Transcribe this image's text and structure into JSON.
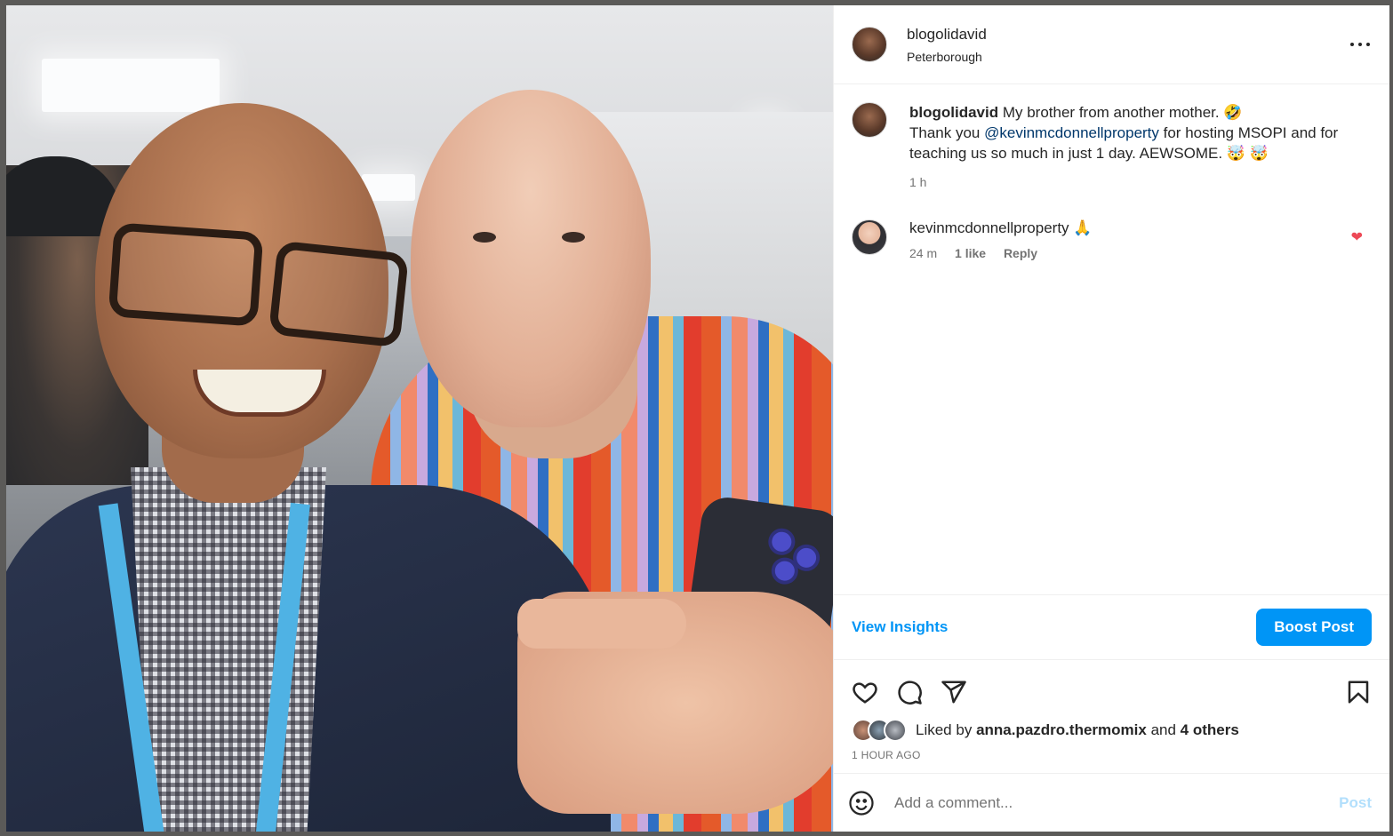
{
  "post": {
    "author": "blogolidavid",
    "location": "Peterborough",
    "caption_line1": "My brother from another mother. 🤣",
    "caption_thank": "Thank you ",
    "caption_mention": "@kevinmcdonnellproperty",
    "caption_rest": " for hosting MSOPI and for teaching us so much in just 1 day. AEWSOME. 🤯 🤯",
    "caption_time": "1 h"
  },
  "comments": [
    {
      "user": "kevinmcdonnellproperty",
      "text": "🙏",
      "time": "24 m",
      "likes": "1 like",
      "reply": "Reply"
    }
  ],
  "insights": {
    "view_label": "View Insights",
    "boost_label": "Boost Post"
  },
  "likes": {
    "prefix": "Liked by ",
    "user": "anna.pazdro.thermomix",
    "and": " and ",
    "others": "4 others",
    "time_ago": "1 HOUR AGO"
  },
  "comment_box": {
    "placeholder": "Add a comment...",
    "post_label": "Post"
  },
  "colors": {
    "accent": "#0095f6",
    "heart": "#ed4956",
    "mention": "#00376b"
  },
  "icons": [
    "more-icon",
    "heart-icon",
    "comment-icon",
    "share-icon",
    "bookmark-icon",
    "emoji-icon"
  ]
}
